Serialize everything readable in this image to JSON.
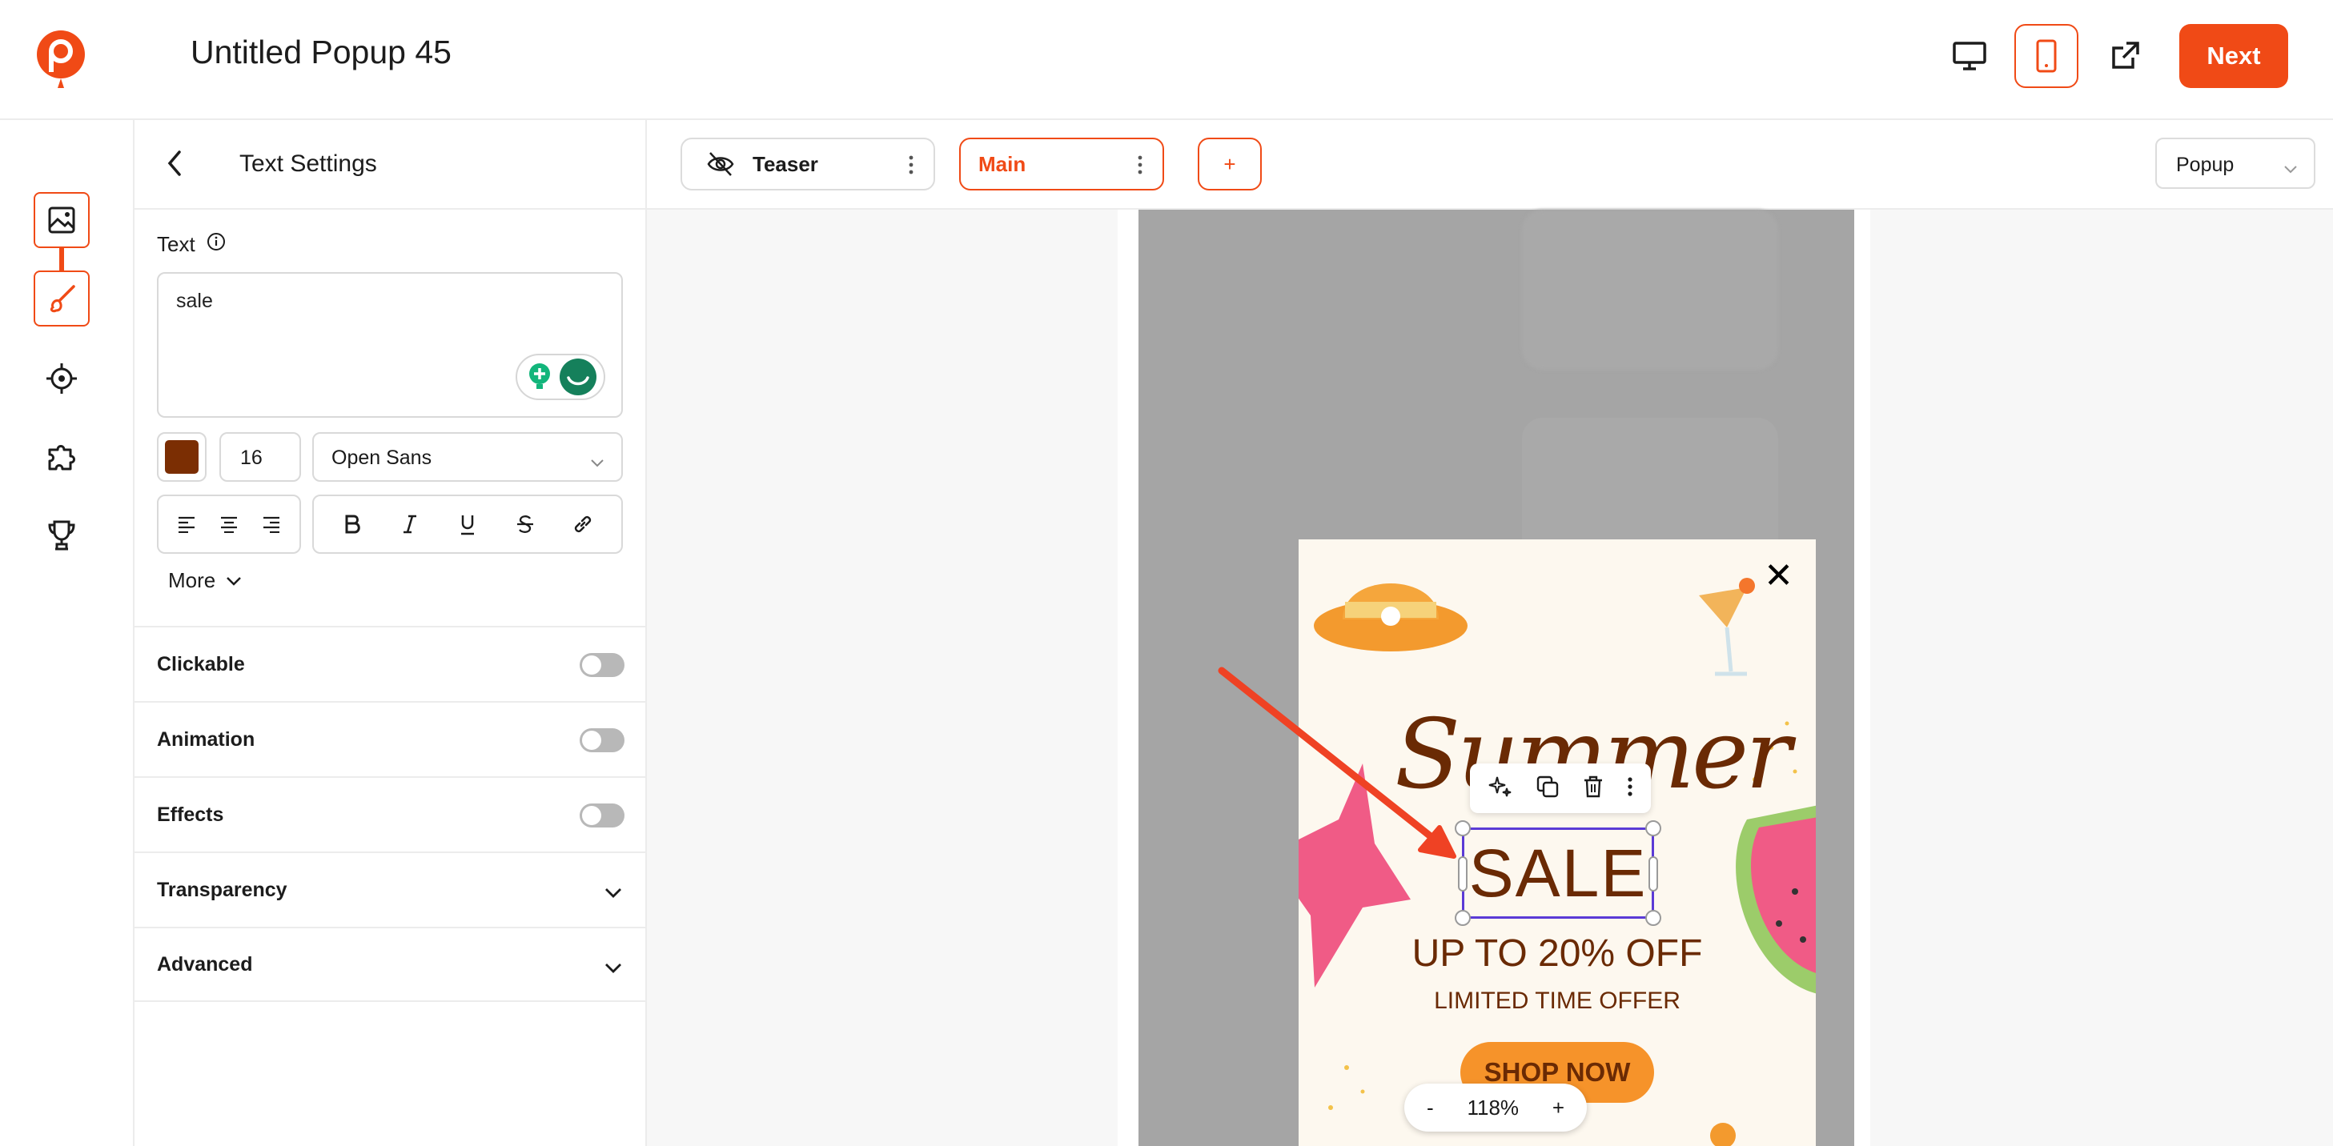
{
  "header": {
    "title": "Untitled Popup 45",
    "next_label": "Next",
    "icons": [
      "desktop-icon",
      "mobile-icon",
      "external-link-icon"
    ]
  },
  "rail": {
    "items": [
      "image-icon",
      "brush-icon",
      "target-icon",
      "puzzle-icon",
      "trophy-icon"
    ],
    "active": "brush-icon"
  },
  "panel": {
    "title": "Text Settings",
    "text_label": "Text",
    "text_value": "sale",
    "color": "#7b2e03",
    "font_size": "16",
    "font_family": "Open Sans",
    "more_label": "More",
    "sections": {
      "clickable": "Clickable",
      "animation": "Animation",
      "effects": "Effects",
      "transparency": "Transparency",
      "advanced": "Advanced"
    }
  },
  "tabs": {
    "teaser": "Teaser",
    "main": "Main",
    "add": "+",
    "type_select": "Popup"
  },
  "popup": {
    "summer": "Summer",
    "sale": "SALE",
    "offer": "UP TO 20% OFF",
    "limited": "LIMITED TIME OFFER",
    "cta": "SHOP NOW",
    "close": "✕"
  },
  "zoom": {
    "minus": "-",
    "value": "118%",
    "plus": "+"
  },
  "colors": {
    "accent": "#f04a16",
    "selection": "#5b3bd6",
    "popup_text": "#6a2a04",
    "cta_bg": "#f6932a"
  }
}
